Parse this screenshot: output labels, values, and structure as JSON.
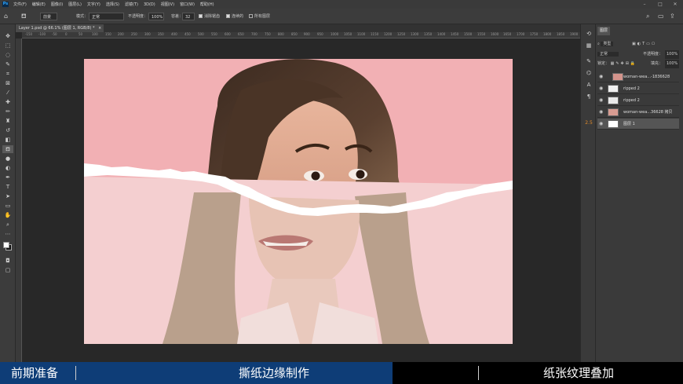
{
  "menu": {
    "logo": "Ps",
    "items": [
      "文件(F)",
      "编辑(E)",
      "图像(I)",
      "图层(L)",
      "文字(Y)",
      "选择(S)",
      "滤镜(T)",
      "3D(D)",
      "视图(V)",
      "窗口(W)",
      "帮助(H)"
    ],
    "window_controls": [
      "–",
      "□",
      "✕"
    ]
  },
  "options": {
    "home_icon": "home-icon",
    "tool_icon": "paint-bucket-icon",
    "fill_select": "前景",
    "mode_label": "模式：",
    "mode_value": "正常",
    "opacity_label": "不透明度：",
    "opacity_value": "100%",
    "tolerance_label": "容差：",
    "tolerance_value": "32",
    "antialias_label": "消除锯齿",
    "contiguous_label": "连续的",
    "alllayers_label": "所有图层"
  },
  "document": {
    "tab_label": "Layer 1.psd @ 66.1% (图层 1, RGB/8) *",
    "close": "×"
  },
  "ruler": {
    "ticks": [
      "-150",
      "-100",
      "-50",
      "0",
      "50",
      "100",
      "150",
      "200",
      "250",
      "300",
      "350",
      "400",
      "450",
      "500",
      "550",
      "600",
      "650",
      "700",
      "750",
      "800",
      "850",
      "900",
      "950",
      "1000",
      "1050",
      "1100",
      "1150",
      "1200",
      "1250",
      "1300",
      "1350",
      "1400",
      "1450",
      "1500",
      "1550",
      "1600",
      "1650",
      "1700",
      "1750",
      "1800",
      "1850",
      "1900"
    ]
  },
  "layers_panel": {
    "tab": "图层",
    "filter_label": "类型",
    "blend_mode": "正常",
    "opacity_label": "不透明度：",
    "opacity_value": "100%",
    "lock_label": "锁定：",
    "fill_label": "填充：",
    "fill_value": "100%",
    "layers": [
      {
        "name": "woman-wea...-1836628",
        "selected": false
      },
      {
        "name": "ripped 2",
        "selected": false
      },
      {
        "name": "ripped 2",
        "selected": false
      },
      {
        "name": "woman-wea...36628 拷贝",
        "selected": false
      },
      {
        "name": "图层 1",
        "selected": true
      }
    ]
  },
  "side_strip_icons": [
    "history-icon",
    "swatches-icon",
    "brush-icon",
    "adjust-icon",
    "text-icon",
    "paragraph-icon"
  ],
  "side_strip_badge": "2.5",
  "caption": {
    "left": "前期准备",
    "middle": "撕纸边缘制作",
    "right": "纸张纹理叠加"
  },
  "colors": {
    "photo_background": "#f2b0b4",
    "faded_background": "#f4cfd0",
    "caption_blue": "#0e3d77"
  }
}
